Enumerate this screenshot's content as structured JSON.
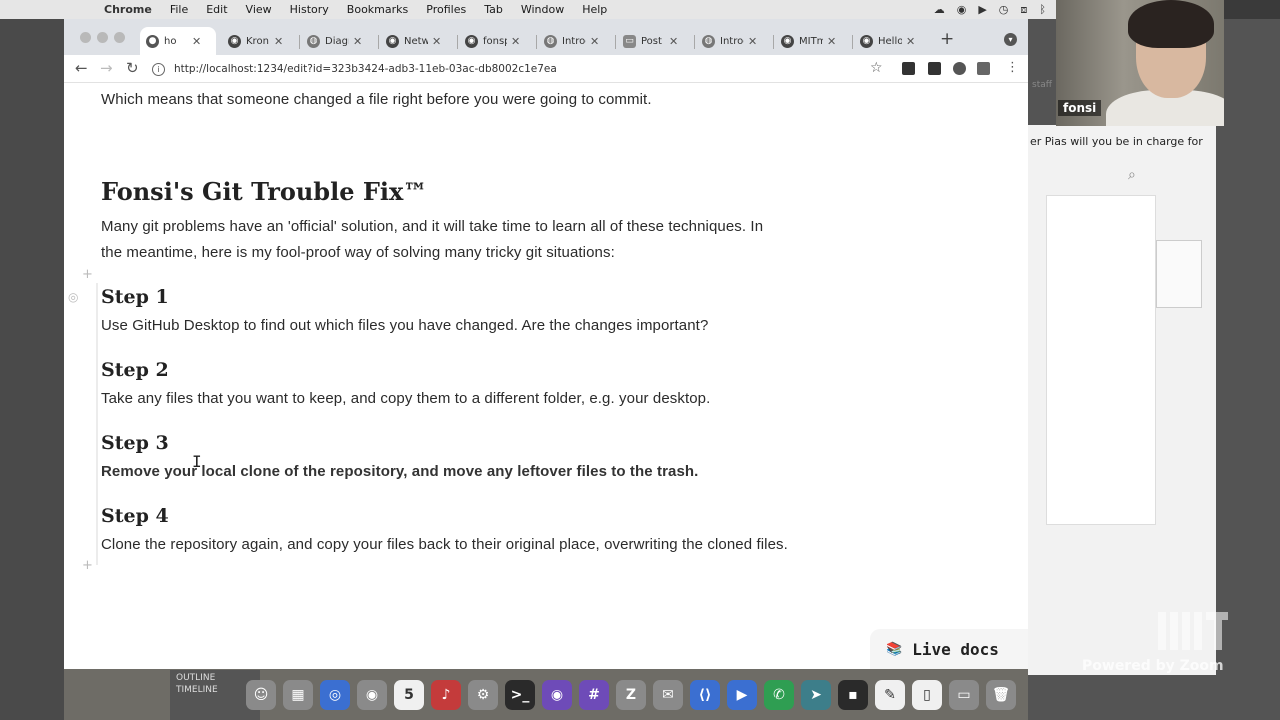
{
  "menubar": {
    "app": "Chrome",
    "items": [
      "File",
      "Edit",
      "View",
      "History",
      "Bookmarks",
      "Profiles",
      "Tab",
      "Window",
      "Help"
    ]
  },
  "tabs": [
    {
      "label": "ho",
      "icon": "pluto-icon",
      "active": true
    },
    {
      "label": "Kron",
      "icon": "github-icon"
    },
    {
      "label": "Diagn",
      "icon": "globe-icon"
    },
    {
      "label": "Netw",
      "icon": "github-icon"
    },
    {
      "label": "fonsp",
      "icon": "github-icon"
    },
    {
      "label": "Introd",
      "icon": "globe-icon"
    },
    {
      "label": "Post",
      "icon": "tab-icon"
    },
    {
      "label": "Introd",
      "icon": "globe-icon"
    },
    {
      "label": "MITma",
      "icon": "github-icon"
    },
    {
      "label": "Hello",
      "icon": "github-icon"
    }
  ],
  "url": "http://localhost:1234/edit?id=323b3424-adb3-11eb-03ac-db8002c1e7ea",
  "notebook": {
    "intro_line": "Which means that someone changed a file right before you were going to commit.",
    "heading": "Fonsi's Git Trouble Fix™",
    "paragraph_1": "Many git problems have an 'official' solution, and it will take time to learn all of these techniques. In",
    "paragraph_2": "the meantime, here is my fool-proof way of solving many tricky git situations:",
    "steps": [
      {
        "title": "Step 1",
        "text": "Use GitHub Desktop to find out which files you have changed. Are the changes important?"
      },
      {
        "title": "Step 2",
        "text": "Take any files that you want to keep, and copy them to a different folder, e.g. your desktop."
      },
      {
        "title": "Step 3",
        "text": "Remove your local clone of the repository, and move any leftover files to the trash."
      },
      {
        "title": "Step 4",
        "text": "Clone the repository again, and copy your files back to their original place, overwriting the cloned files."
      }
    ]
  },
  "live_docs": "Live docs",
  "side_window": {
    "staff": "staff",
    "question": "er Pias will you be in charge for"
  },
  "zoom": {
    "name": "fonsi",
    "watermark": "Powered by Zoom"
  },
  "dock": {
    "outline": "OUTLINE",
    "timeline": "TIMELINE",
    "calendar_day": "5"
  }
}
